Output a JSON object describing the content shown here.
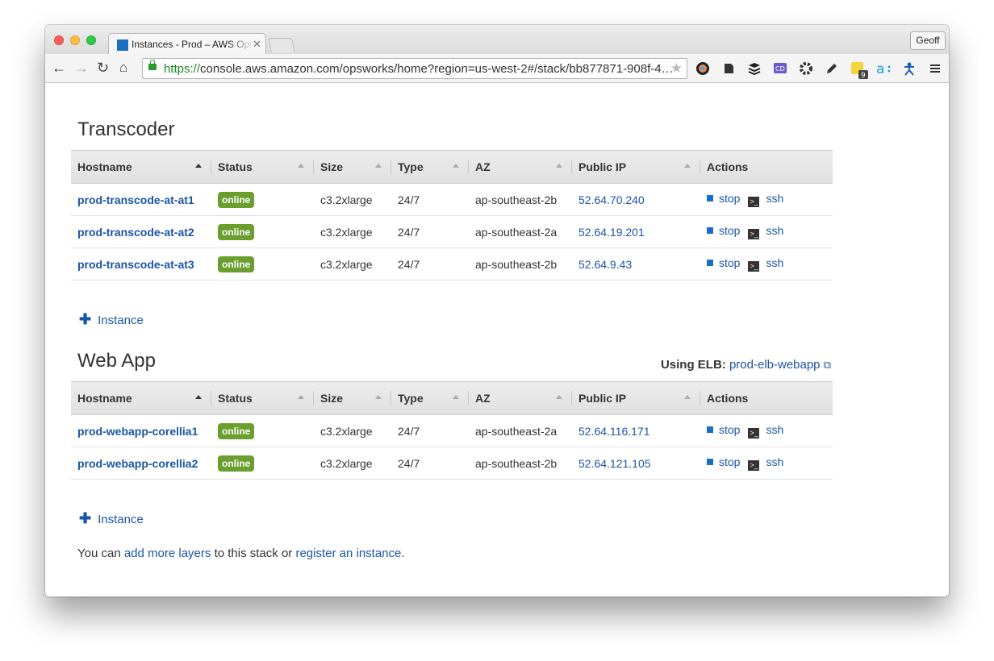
{
  "browser": {
    "tab_title": "Instances - Prod – AWS OpsWorks",
    "profile": "Geoff",
    "url_scheme": "https://",
    "url_rest": "console.aws.amazon.com/opsworks/home?region=us-west-2#/stack/bb877871-908f-4…",
    "extensions": [
      "color-wheel-icon",
      "evernote-icon",
      "buffer-icon",
      "cd-icon",
      "gear-icon",
      "pencil-icon",
      "puzzle-icon",
      "amazon-assistant-icon",
      "person-icon",
      "menu-icon"
    ],
    "extension_badge": "9"
  },
  "columns": [
    "Hostname",
    "Status",
    "Size",
    "Type",
    "AZ",
    "Public IP",
    "Actions"
  ],
  "layers": [
    {
      "title": "Transcoder",
      "add_label": "Instance",
      "rows": [
        {
          "hostname": "prod-transcode-at-at1",
          "status": "online",
          "size": "c3.2xlarge",
          "type": "24/7",
          "az": "ap-southeast-2b",
          "ip": "52.64.70.240"
        },
        {
          "hostname": "prod-transcode-at-at2",
          "status": "online",
          "size": "c3.2xlarge",
          "type": "24/7",
          "az": "ap-southeast-2a",
          "ip": "52.64.19.201"
        },
        {
          "hostname": "prod-transcode-at-at3",
          "status": "online",
          "size": "c3.2xlarge",
          "type": "24/7",
          "az": "ap-southeast-2b",
          "ip": "52.64.9.43"
        }
      ]
    },
    {
      "title": "Web App",
      "add_label": "Instance",
      "elb_label": "Using ELB:",
      "elb_name": "prod-elb-webapp",
      "rows": [
        {
          "hostname": "prod-webapp-corellia1",
          "status": "online",
          "size": "c3.2xlarge",
          "type": "24/7",
          "az": "ap-southeast-2a",
          "ip": "52.64.116.171"
        },
        {
          "hostname": "prod-webapp-corellia2",
          "status": "online",
          "size": "c3.2xlarge",
          "type": "24/7",
          "az": "ap-southeast-2b",
          "ip": "52.64.121.105"
        }
      ]
    }
  ],
  "actions": {
    "stop": "stop",
    "ssh": "ssh"
  },
  "footer": {
    "prefix": "You can ",
    "link1": "add more layers",
    "middle": " to this stack or ",
    "link2": "register an instance",
    "suffix": "."
  },
  "colors": {
    "link": "#1a55a8",
    "online": "#6a9e2d"
  }
}
